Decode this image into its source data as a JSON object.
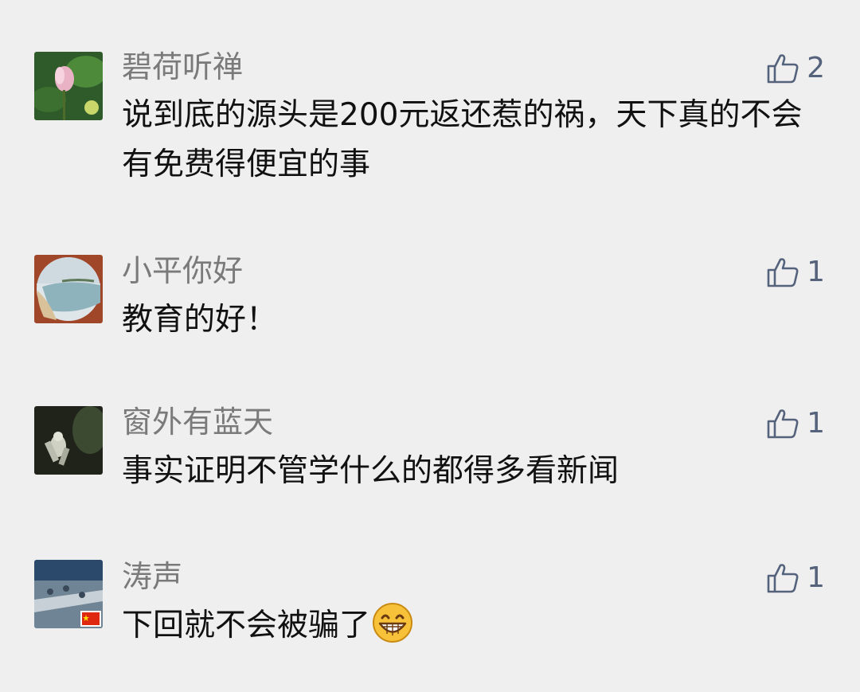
{
  "comments": [
    {
      "user": "碧荷听禅",
      "text": "说到底的源头是200元返还惹的祸，天下真的不会有免费得便宜的事",
      "likes": "2",
      "avatar_icon": "lotus-avatar"
    },
    {
      "user": "小平你好",
      "text": "教育的好！",
      "likes": "1",
      "avatar_icon": "beach-avatar"
    },
    {
      "user": "窗外有蓝天",
      "text": "事实证明不管学什么的都得多看新闻",
      "likes": "1",
      "avatar_icon": "astronaut-avatar"
    },
    {
      "user": "涛声",
      "text": "下回就不会被骗了",
      "likes": "1",
      "avatar_icon": "ship-deck-avatar",
      "emoji": "grinning-emoji"
    }
  ],
  "colors": {
    "background": "#efefef",
    "name": "#7a7a7a",
    "text": "#111111",
    "like": "#55627c"
  }
}
